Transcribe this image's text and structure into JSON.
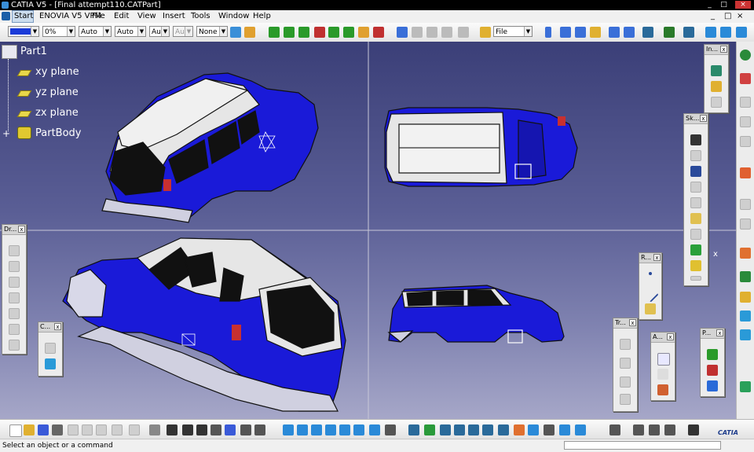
{
  "window": {
    "title": "CATIA V5 - [Final attempt110.CATPart]",
    "minimize": "_",
    "restore": "□",
    "close": "×"
  },
  "menu": [
    "Start",
    "ENOVIA V5 VPM",
    "File",
    "Edit",
    "View",
    "Insert",
    "Tools",
    "Window",
    "Help"
  ],
  "toolbar": {
    "transparency": "0%",
    "line_thickness": "Auto",
    "line_type": "Auto",
    "layer_1": "Aut",
    "layer_2": "Aut",
    "layer_3": "None",
    "file_combo": "File"
  },
  "tree": {
    "root": "Part1",
    "items": [
      "xy plane",
      "yz plane",
      "zx plane",
      "PartBody"
    ]
  },
  "floating_toolbars": {
    "drafting": "Dr...",
    "c": "C...",
    "insert": "In...",
    "sketch": "Sk...",
    "r": "R...",
    "tr": "Tr...",
    "a": "A...",
    "p": "P..."
  },
  "axis_label": "x",
  "status": {
    "message": "Select an object or a command"
  },
  "colors": {
    "car_blue": "#1a1ad8",
    "car_white": "#e6e6e6",
    "viewport_top": "#3b3f78",
    "viewport_bottom": "#a6a7c8"
  },
  "brand": "CATIA"
}
